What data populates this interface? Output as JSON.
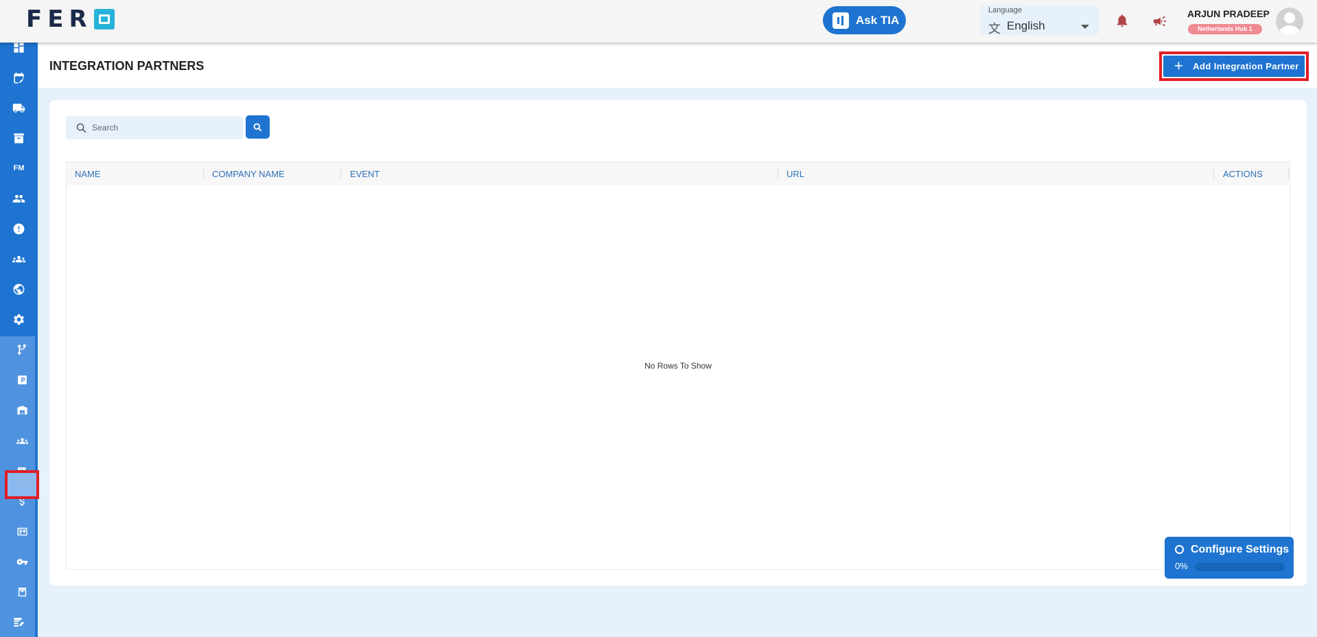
{
  "app": {
    "logo_text": "FER",
    "ask_tia": "Ask TIA"
  },
  "language": {
    "label": "Language",
    "value": "English"
  },
  "user": {
    "name": "ARJUN PRADEEP",
    "hub": "Netherlands Hub 1"
  },
  "sidebar": {
    "fm_label": "FM",
    "icons": [
      "dashboard-icon",
      "calendar-edit-icon",
      "truck-icon",
      "archive-icon",
      "fm-icon",
      "users-icon",
      "alert-icon",
      "group-icon",
      "support-icon",
      "settings-icon",
      "branch-icon",
      "parking-icon",
      "warehouse-icon",
      "integration-partners-icon",
      "table-settings-icon",
      "dollar-icon",
      "id-card-icon",
      "key-icon",
      "inbox-icon",
      "notes-icon"
    ],
    "selected": "integration-partners-icon"
  },
  "page": {
    "title": "INTEGRATION PARTNERS",
    "add_button": "Add Integration Partner"
  },
  "search": {
    "placeholder": "Search",
    "value": ""
  },
  "table": {
    "columns": [
      "NAME",
      "COMPANY NAME",
      "EVENT",
      "URL",
      "ACTIONS"
    ],
    "rows": [],
    "empty_text": "No Rows To Show"
  },
  "configure": {
    "title": "Configure Settings",
    "progress_label": "0%",
    "progress": 0
  },
  "colors": {
    "primary": "#1e74d0",
    "highlight": "#e11d26",
    "background": "#e6f1fb"
  }
}
